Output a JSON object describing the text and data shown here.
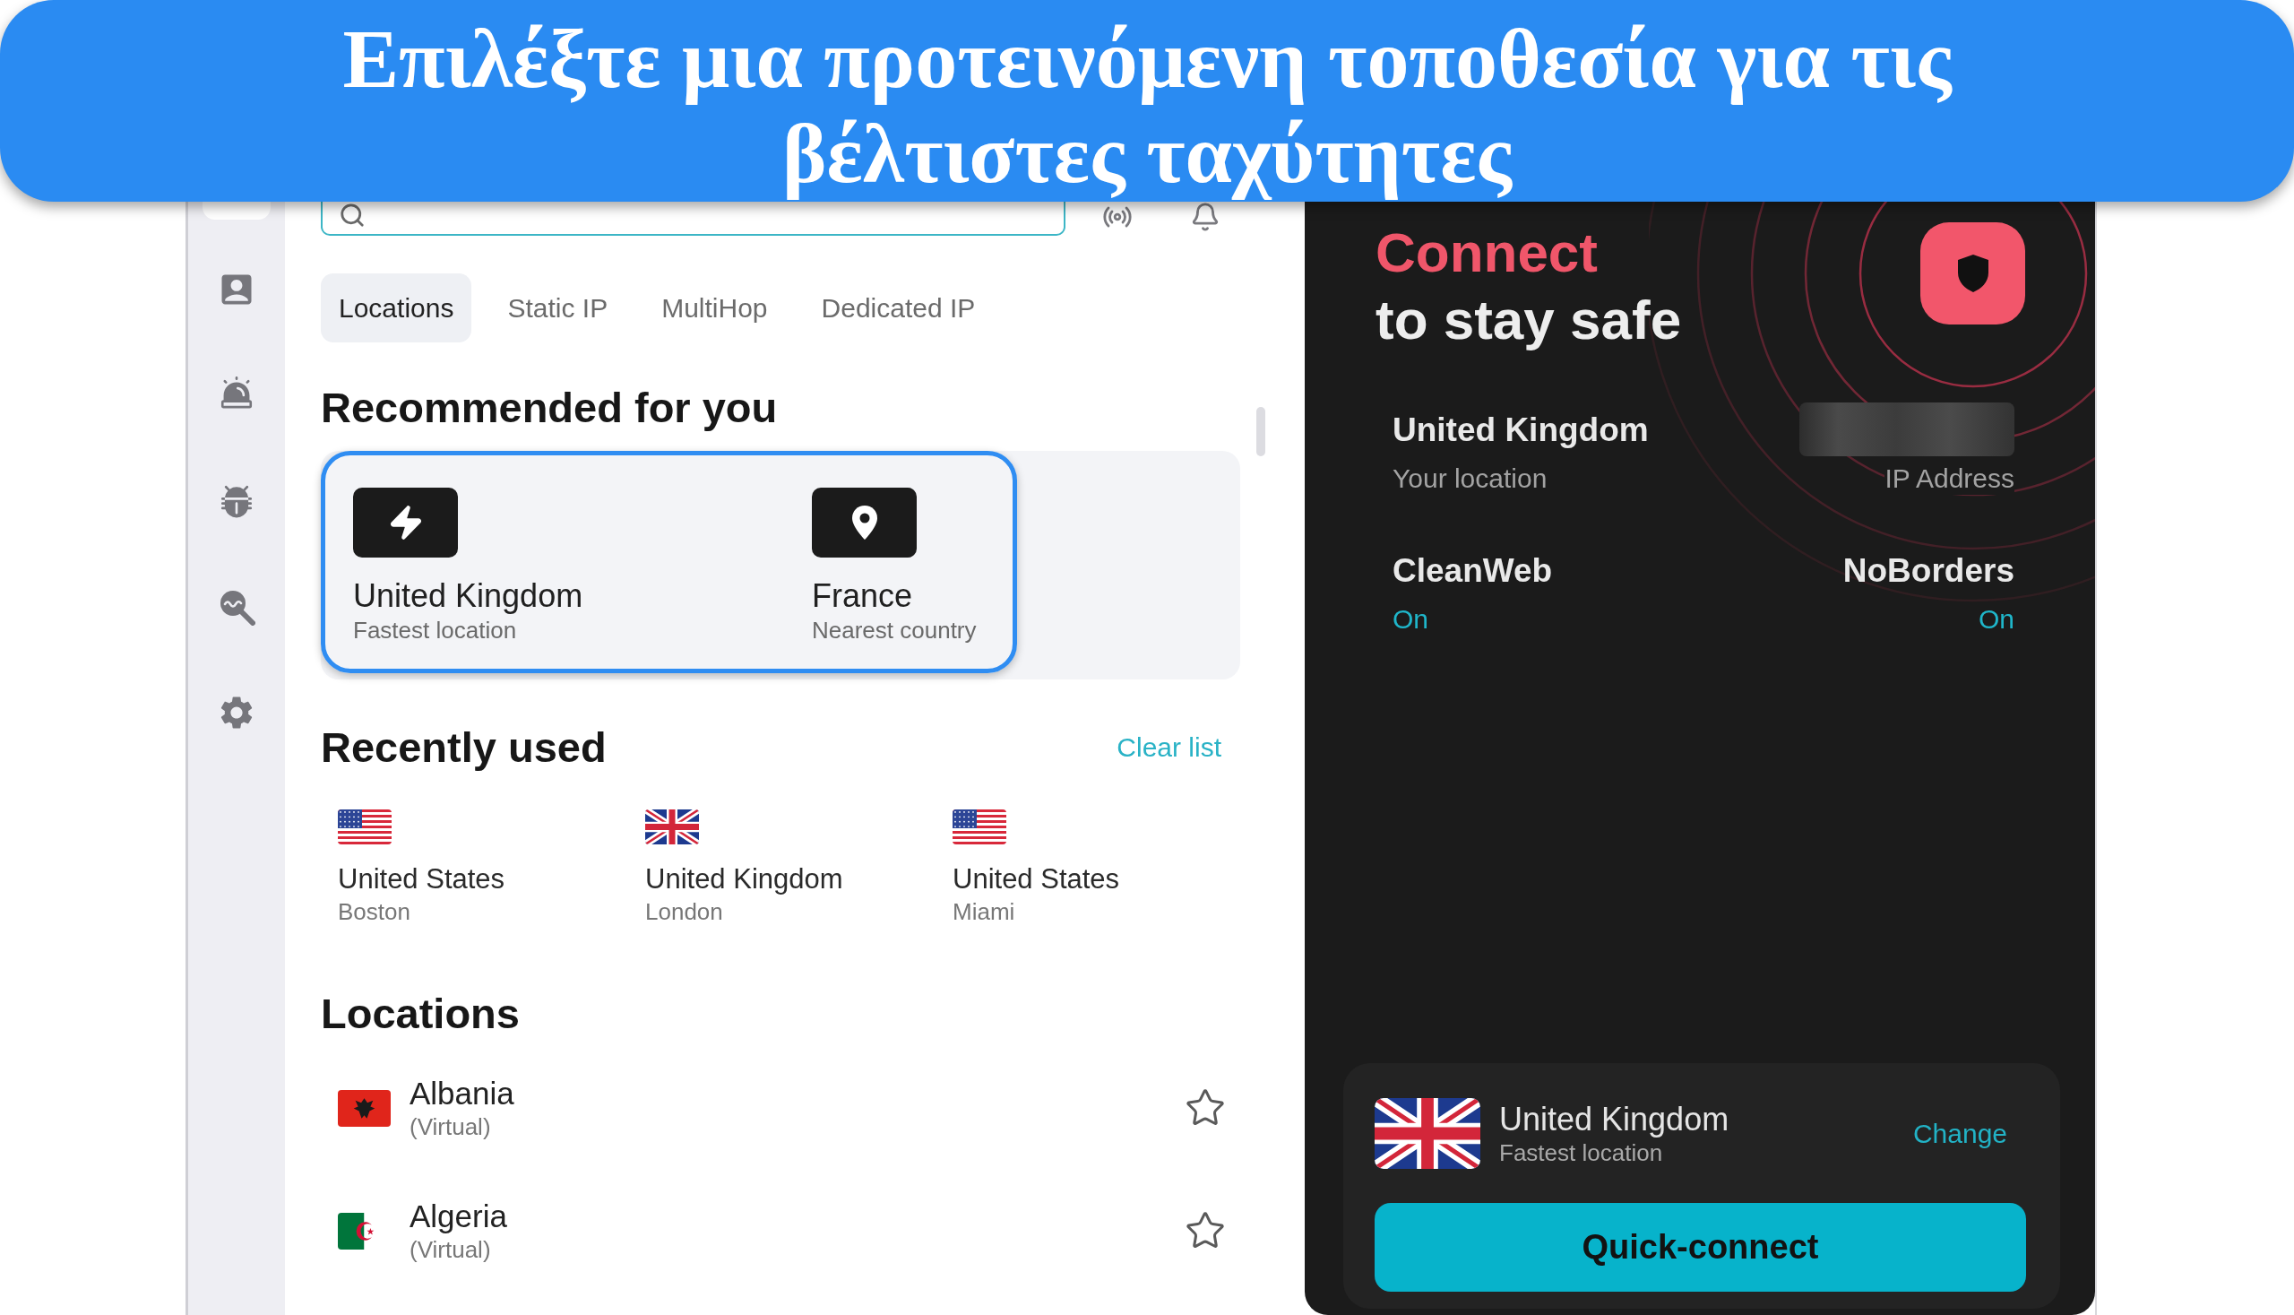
{
  "banner": {
    "title": "Επιλέξτε μια προτεινόμενη τοποθεσία για τις βέλτιστες ταχύτητες"
  },
  "sidebar": {
    "items": [
      {
        "selected": true
      },
      {
        "kind": "account",
        "selected": false
      },
      {
        "kind": "alert",
        "selected": false
      },
      {
        "kind": "bug",
        "selected": false
      },
      {
        "kind": "search",
        "selected": false
      },
      {
        "kind": "settings",
        "selected": false
      }
    ]
  },
  "search": {
    "focused": true
  },
  "toolbar": {
    "buttons": [
      {
        "kind": "signal"
      },
      {
        "kind": "bell"
      }
    ]
  },
  "tabs": [
    {
      "label": "Locations",
      "selected": true
    },
    {
      "label": "Static IP",
      "selected": false
    },
    {
      "label": "MultiHop",
      "selected": false
    },
    {
      "label": "Dedicated IP",
      "selected": false
    }
  ],
  "recommended": {
    "title": "Recommended for you",
    "highlighted": true,
    "items": [
      {
        "kind": "fastest",
        "name": "United Kingdom",
        "caption": "Fastest location"
      },
      {
        "kind": "nearest",
        "name": "France",
        "caption": "Nearest country"
      }
    ]
  },
  "recently_used": {
    "title": "Recently used",
    "action": "Clear list",
    "items": [
      {
        "kind": "us",
        "name": "United States",
        "city": "Boston"
      },
      {
        "kind": "uk",
        "name": "United Kingdom",
        "city": "London"
      },
      {
        "kind": "us",
        "name": "United States",
        "city": "Miami"
      }
    ]
  },
  "locations": {
    "title": "Locations",
    "items": [
      {
        "kind": "albania",
        "name": "Albania",
        "note": "(Virtual)",
        "favorite": false
      },
      {
        "kind": "algeria",
        "name": "Algeria",
        "note": "(Virtual)",
        "favorite": false
      }
    ]
  },
  "status_panel": {
    "headline": "Connect",
    "subheadline": "to stay safe",
    "connected": false,
    "location": {
      "value": "United Kingdom",
      "label": "Your location"
    },
    "ip": {
      "blurred": true,
      "label": "IP Address"
    },
    "features": [
      {
        "name": "CleanWeb",
        "status": "On",
        "on": true
      },
      {
        "name": "NoBorders",
        "status": "On",
        "on": true
      }
    ]
  },
  "quick_connect": {
    "kind": "uk",
    "name": "United Kingdom",
    "caption": "Fastest location",
    "action": "Change",
    "button": "Quick-connect"
  }
}
